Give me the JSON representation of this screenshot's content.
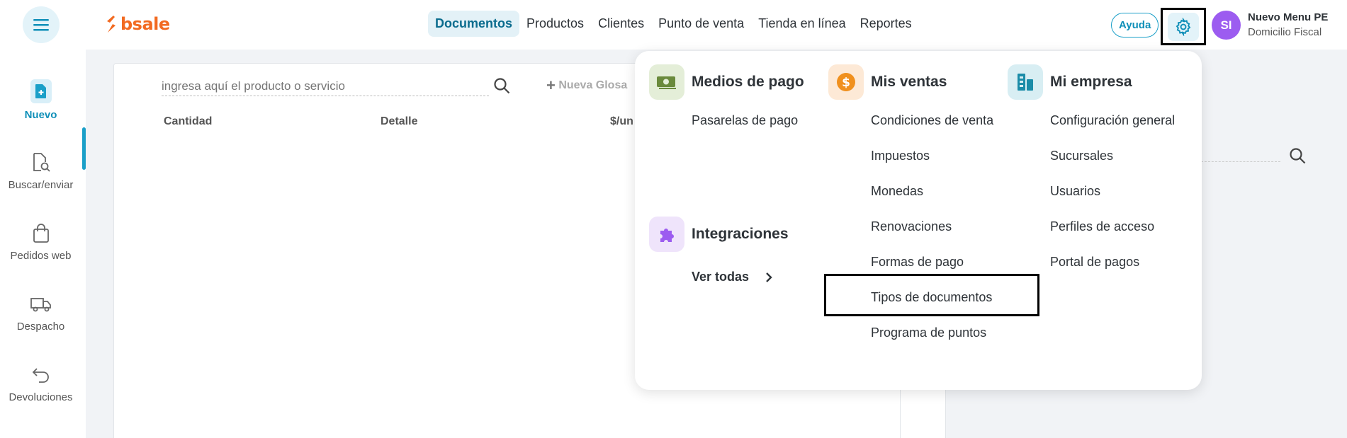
{
  "header": {
    "logo_text": "bsale",
    "nav": [
      {
        "label": "Documentos",
        "active": true
      },
      {
        "label": "Productos"
      },
      {
        "label": "Clientes"
      },
      {
        "label": "Punto de venta"
      },
      {
        "label": "Tienda en línea"
      },
      {
        "label": "Reportes"
      }
    ],
    "help_label": "Ayuda",
    "avatar_initials": "SI",
    "user_name": "Nuevo Menu PE",
    "user_subtitle": "Domicilio Fiscal"
  },
  "sidebar": {
    "items": [
      {
        "label": "Nuevo",
        "icon": "new-document-icon",
        "active": true
      },
      {
        "label": "Buscar/enviar",
        "icon": "search-document-icon"
      },
      {
        "label": "Pedidos web",
        "icon": "shopping-bag-icon"
      },
      {
        "label": "Despacho",
        "icon": "truck-icon"
      },
      {
        "label": "Devoluciones",
        "icon": "return-arrow-icon"
      }
    ]
  },
  "main": {
    "search_placeholder": "ingresa aquí el producto o servicio",
    "new_glosa_label": "Nueva Glosa",
    "columns": [
      "Cantidad",
      "Detalle",
      "$/un"
    ]
  },
  "settings_menu": {
    "medios_de_pago": {
      "title": "Medios de pago",
      "icon": "money-icon",
      "items": [
        "Pasarelas de pago"
      ]
    },
    "integraciones": {
      "title": "Integraciones",
      "icon": "puzzle-icon",
      "link": "Ver todas"
    },
    "mis_ventas": {
      "title": "Mis ventas",
      "icon": "dollar-coin-icon",
      "items": [
        "Condiciones de venta",
        "Impuestos",
        "Monedas",
        "Renovaciones",
        "Formas de pago",
        "Tipos de documentos",
        "Programa de puntos"
      ]
    },
    "mi_empresa": {
      "title": "Mi empresa",
      "icon": "building-icon",
      "items": [
        "Configuración general",
        "Sucursales",
        "Usuarios",
        "Perfiles de acceso",
        "Portal de pagos"
      ]
    }
  },
  "colors": {
    "brand_orange": "#f26a21",
    "accent_blue": "#1a9fc8",
    "avatar_purple": "#9c5cf0"
  }
}
